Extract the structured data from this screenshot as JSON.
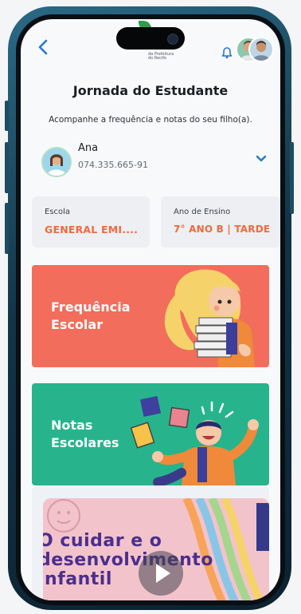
{
  "header": {
    "title": "Jornada do Estudante",
    "subtitle": "Acompanhe a frequência e notas do seu filho(a).",
    "brand_line1": "da Prefeitura",
    "brand_line2": "do Recife",
    "icons": [
      "back-arrow-icon",
      "bell-icon",
      "profile-avatar"
    ]
  },
  "student": {
    "name": "Ana",
    "id": "074.335.665-91"
  },
  "school": {
    "label": "Escola",
    "value": "GENERAL EMI...."
  },
  "grade": {
    "label": "Ano de Ensino",
    "value": "7° ANO B | TARDE"
  },
  "tiles": [
    {
      "label_line1": "Frequência",
      "label_line2": "Escolar",
      "color": "#f26d5b"
    },
    {
      "label_line1": "Notas",
      "label_line2": "Escolares",
      "color": "#27b48c"
    }
  ],
  "video": {
    "line1": "O cuidar e o",
    "line2": "desenvolvimento",
    "line3": "infantil"
  },
  "colors": {
    "accent": "#2577d1",
    "orange": "#f06a3b",
    "device_frame": "#1e5570"
  }
}
